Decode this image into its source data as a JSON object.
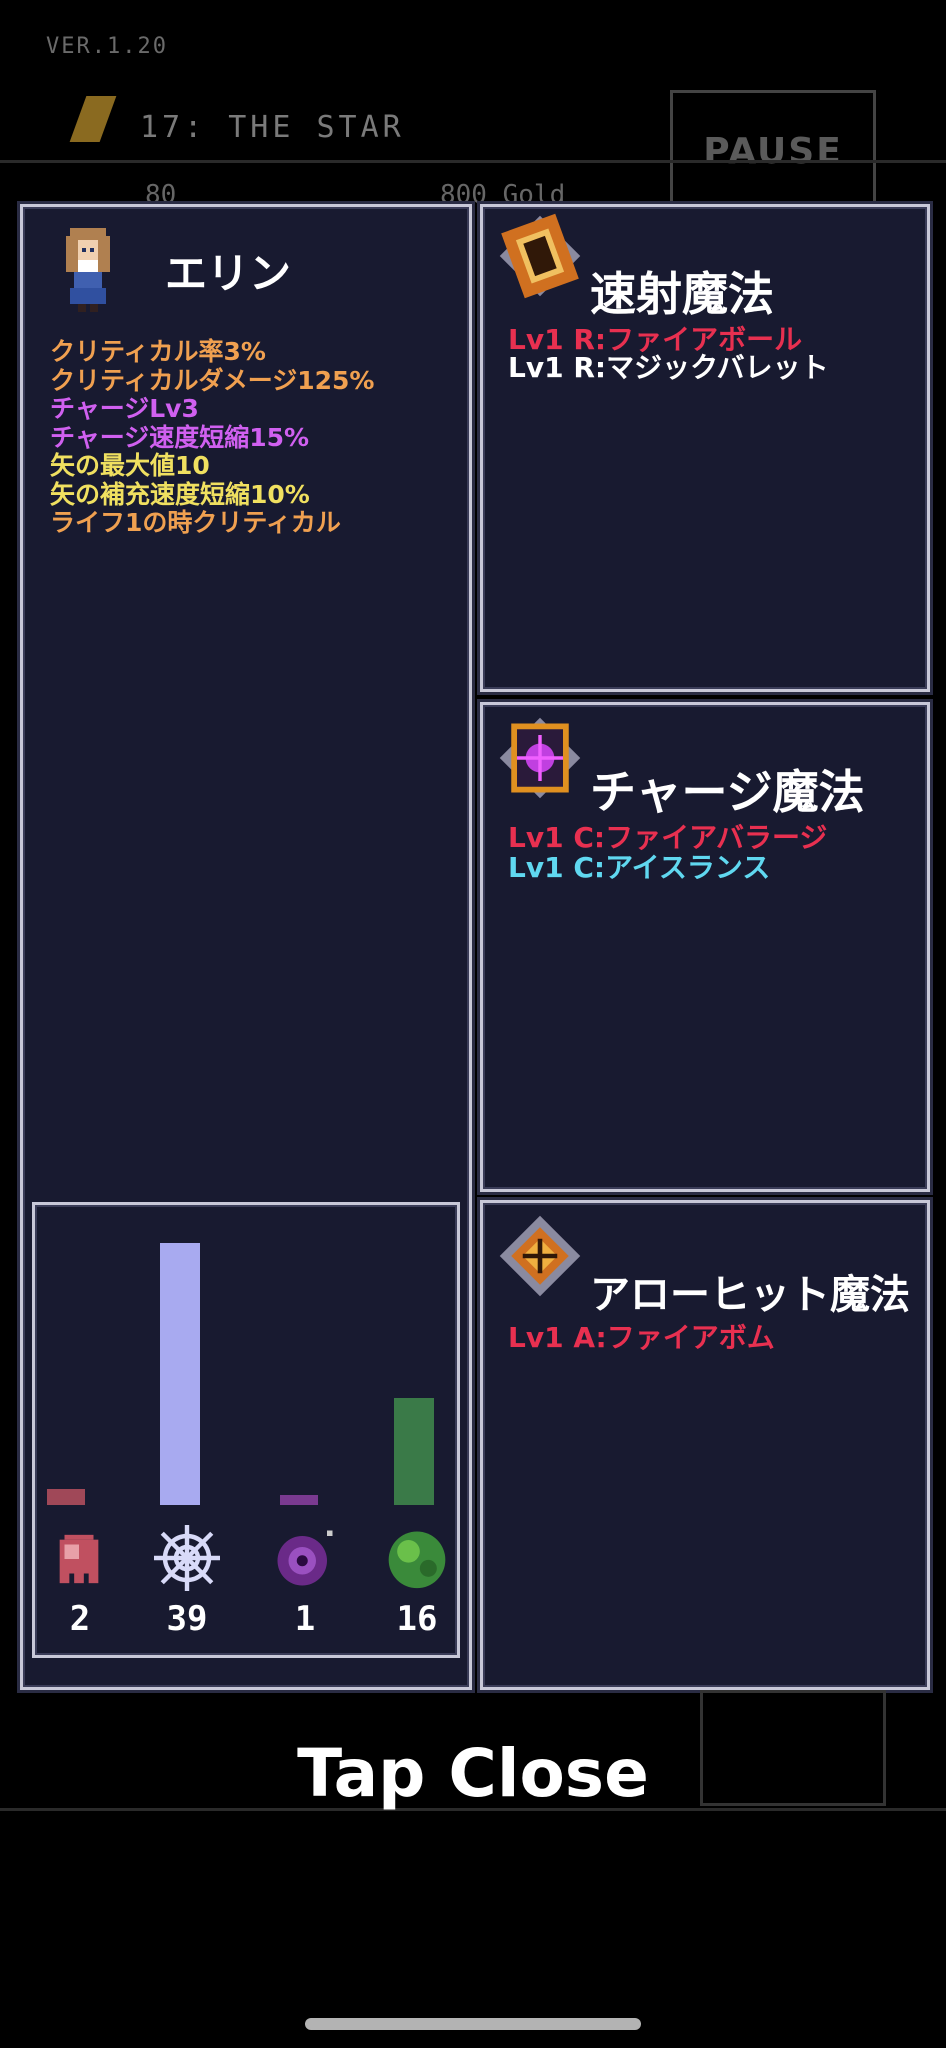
{
  "hud": {
    "version": "VER.1.20",
    "stage": "17: THE STAR",
    "pause_label": "PAUSE",
    "count": "80",
    "gold": "800 Gold"
  },
  "character": {
    "name": "エリン",
    "stats": [
      {
        "text": "クリティカル率3%",
        "color": "#f0a050"
      },
      {
        "text": "クリティカルダメージ125%",
        "color": "#f0a050"
      },
      {
        "text": "チャージLv3",
        "color": "#d060f0"
      },
      {
        "text": "チャージ速度短縮15%",
        "color": "#d060f0"
      },
      {
        "text": "矢の最大値10",
        "color": "#f0e060"
      },
      {
        "text": "矢の補充速度短縮10%",
        "color": "#f0e060"
      },
      {
        "text": "ライフ1の時クリティカル",
        "color": "#f0a050"
      }
    ]
  },
  "resources": [
    {
      "name": "ghost",
      "count": "2",
      "level": 0.06,
      "color": "#a04858"
    },
    {
      "name": "web",
      "count": "39",
      "level": 1.0,
      "color": "#a8aaf0"
    },
    {
      "name": "dark-orb",
      "count": "1",
      "level": 0.03,
      "color": "#7a3a90"
    },
    {
      "name": "slime",
      "count": "16",
      "level": 0.41,
      "color": "#3a7a48"
    }
  ],
  "magic": {
    "rapid": {
      "title": "速射魔法",
      "icon": "rapid-scroll-icon",
      "lines": [
        {
          "text": "Lv1 R:ファイアボール",
          "color": "#e83050"
        },
        {
          "text": "Lv1 R:マジックバレット",
          "color": "#ffffff"
        }
      ]
    },
    "charge": {
      "title": "チャージ魔法",
      "icon": "charge-rune-icon",
      "lines": [
        {
          "text": "Lv1 C:ファイアバラージ",
          "color": "#e83050"
        },
        {
          "text": "Lv1 C:アイスランス",
          "color": "#60d8f0"
        }
      ]
    },
    "arrowhit": {
      "title": "アローヒット魔法",
      "icon": "arrowhit-rune-icon",
      "lines": [
        {
          "text": "Lv1 A:ファイアボム",
          "color": "#e83050"
        }
      ]
    }
  },
  "footer": {
    "tap_close": "Tap Close"
  }
}
